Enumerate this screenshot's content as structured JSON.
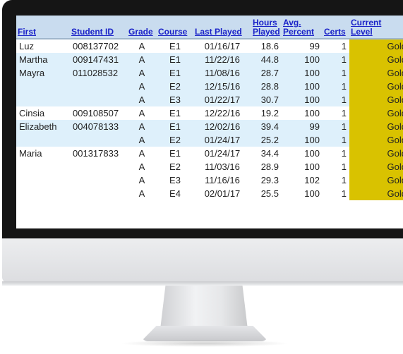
{
  "table": {
    "headers": {
      "first": "First",
      "student_id": "Student ID",
      "grade": "Grade",
      "course": "Course",
      "last_played": "Last Played",
      "hours_played": [
        "Hours",
        "Played"
      ],
      "avg_percent": [
        "Avg.",
        "Percent"
      ],
      "certs": "Certs",
      "current_level": [
        "Current",
        "Level"
      ]
    },
    "rows": [
      {
        "first": "Luz",
        "student_id": "008137702",
        "grade": "A",
        "course": "E1",
        "last_played": "01/16/17",
        "hours": "18.6",
        "avg": "99",
        "certs": "1",
        "level": "Gold"
      },
      {
        "first": "Martha",
        "student_id": "009147431",
        "grade": "A",
        "course": "E1",
        "last_played": "11/22/16",
        "hours": "44.8",
        "avg": "100",
        "certs": "1",
        "level": "Gold"
      },
      {
        "first": "Mayra",
        "student_id": "011028532",
        "grade": "A",
        "course": "E1",
        "last_played": "11/08/16",
        "hours": "28.7",
        "avg": "100",
        "certs": "1",
        "level": "Gold"
      },
      {
        "first": "",
        "student_id": "",
        "grade": "A",
        "course": "E2",
        "last_played": "12/15/16",
        "hours": "28.8",
        "avg": "100",
        "certs": "1",
        "level": "Gold"
      },
      {
        "first": "",
        "student_id": "",
        "grade": "A",
        "course": "E3",
        "last_played": "01/22/17",
        "hours": "30.7",
        "avg": "100",
        "certs": "1",
        "level": "Gold"
      },
      {
        "first": "Cinsia",
        "student_id": "009108507",
        "grade": "A",
        "course": "E1",
        "last_played": "12/22/16",
        "hours": "19.2",
        "avg": "100",
        "certs": "1",
        "level": "Gold"
      },
      {
        "first": "Elizabeth",
        "student_id": "004078133",
        "grade": "A",
        "course": "E1",
        "last_played": "12/02/16",
        "hours": "39.4",
        "avg": "99",
        "certs": "1",
        "level": "Gold"
      },
      {
        "first": "",
        "student_id": "",
        "grade": "A",
        "course": "E2",
        "last_played": "01/24/17",
        "hours": "25.2",
        "avg": "100",
        "certs": "1",
        "level": "Gold"
      },
      {
        "first": "Maria",
        "student_id": "001317833",
        "grade": "A",
        "course": "E1",
        "last_played": "01/24/17",
        "hours": "34.4",
        "avg": "100",
        "certs": "1",
        "level": "Gold"
      },
      {
        "first": "",
        "student_id": "",
        "grade": "A",
        "course": "E2",
        "last_played": "11/03/16",
        "hours": "28.9",
        "avg": "100",
        "certs": "1",
        "level": "Gold"
      },
      {
        "first": "",
        "student_id": "",
        "grade": "A",
        "course": "E3",
        "last_played": "11/16/16",
        "hours": "29.3",
        "avg": "102",
        "certs": "1",
        "level": "Gold"
      },
      {
        "first": "",
        "student_id": "",
        "grade": "A",
        "course": "E4",
        "last_played": "02/01/17",
        "hours": "25.5",
        "avg": "100",
        "certs": "1",
        "level": "Gold"
      }
    ],
    "row_shading": [
      "light",
      "tint",
      "tint",
      "tint",
      "tint",
      "light",
      "tint",
      "tint",
      "light",
      "light",
      "light",
      "light"
    ]
  },
  "colors": {
    "header_bg": "#c9dcef",
    "header_link": "#1a22c8",
    "row_tint": "#def0fb",
    "gold_level": "#d9c200",
    "bezel": "#151515"
  }
}
